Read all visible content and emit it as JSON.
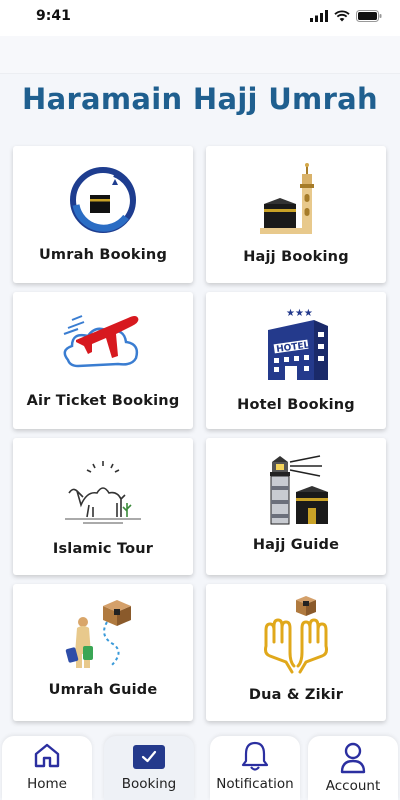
{
  "status_bar": {
    "time": "9:41"
  },
  "app": {
    "title": "Haramain Hajj Umrah"
  },
  "menu": [
    {
      "label": "Umrah Booking",
      "icon": "umrah-booking-icon"
    },
    {
      "label": "Hajj Booking",
      "icon": "hajj-booking-icon"
    },
    {
      "label": "Air Ticket Booking",
      "icon": "airplane-icon"
    },
    {
      "label": "Hotel Booking",
      "icon": "hotel-icon"
    },
    {
      "label": "Islamic Tour",
      "icon": "camel-icon"
    },
    {
      "label": "Hajj Guide",
      "icon": "hajj-guide-icon"
    },
    {
      "label": "Umrah Guide",
      "icon": "umrah-guide-icon"
    },
    {
      "label": "Dua & Zikir",
      "icon": "praying-hands-icon"
    }
  ],
  "bottom_nav": [
    {
      "label": "Home",
      "icon": "home-icon"
    },
    {
      "label": "Booking",
      "icon": "checkbox-icon",
      "active": true
    },
    {
      "label": "Notification",
      "icon": "bell-icon"
    },
    {
      "label": "Account",
      "icon": "user-icon"
    }
  ],
  "colors": {
    "title": "#1f5f8f",
    "accent": "#243a8c",
    "nav_icon": "#2b2fa0"
  }
}
